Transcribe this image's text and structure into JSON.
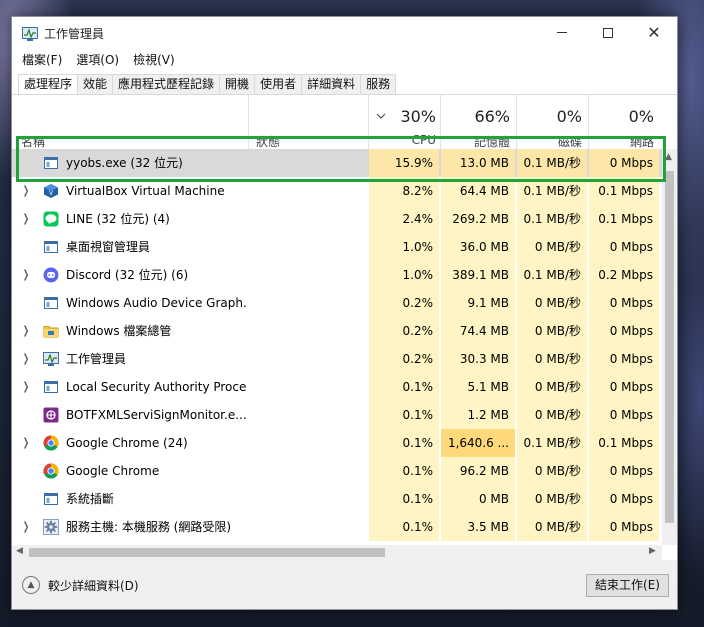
{
  "window": {
    "title": "工作管理員"
  },
  "menu": [
    "檔案(F)",
    "選項(O)",
    "檢視(V)"
  ],
  "tabs": [
    "處理程序",
    "效能",
    "應用程式歷程記錄",
    "開機",
    "使用者",
    "詳細資料",
    "服務"
  ],
  "active_tab": 0,
  "columns": {
    "name": "名稱",
    "status": "狀態",
    "cpu": {
      "pct": "30%",
      "label": "CPU"
    },
    "memory": {
      "pct": "66%",
      "label": "記憶體"
    },
    "disk": {
      "pct": "0%",
      "label": "磁碟"
    },
    "network": {
      "pct": "0%",
      "label": "網路"
    }
  },
  "processes": [
    {
      "name": "yyobs.exe (32 位元)",
      "icon": "app-window-icon",
      "expandable": false,
      "cpu": "15.9%",
      "mem": "13.0 MB",
      "disk": "0.1 MB/秒",
      "net": "0 Mbps",
      "selected": true
    },
    {
      "name": "VirtualBox Virtual Machine",
      "icon": "virtualbox-icon",
      "expandable": true,
      "cpu": "8.2%",
      "mem": "64.4 MB",
      "disk": "0.1 MB/秒",
      "net": "0.1 Mbps"
    },
    {
      "name": "LINE (32 位元) (4)",
      "icon": "line-icon",
      "expandable": true,
      "cpu": "2.4%",
      "mem": "269.2 MB",
      "disk": "0.1 MB/秒",
      "net": "0.1 Mbps"
    },
    {
      "name": "桌面視窗管理員",
      "icon": "app-window-icon",
      "expandable": false,
      "cpu": "1.0%",
      "mem": "36.0 MB",
      "disk": "0 MB/秒",
      "net": "0 Mbps"
    },
    {
      "name": "Discord (32 位元) (6)",
      "icon": "discord-icon",
      "expandable": true,
      "cpu": "1.0%",
      "mem": "389.1 MB",
      "disk": "0.1 MB/秒",
      "net": "0.2 Mbps"
    },
    {
      "name": "Windows Audio Device Graph...",
      "icon": "app-window-icon",
      "expandable": false,
      "cpu": "0.2%",
      "mem": "9.1 MB",
      "disk": "0 MB/秒",
      "net": "0 Mbps"
    },
    {
      "name": "Windows 檔案總管",
      "icon": "folder-icon",
      "expandable": true,
      "cpu": "0.2%",
      "mem": "74.4 MB",
      "disk": "0 MB/秒",
      "net": "0 Mbps"
    },
    {
      "name": "工作管理員",
      "icon": "task-manager-icon",
      "expandable": true,
      "cpu": "0.2%",
      "mem": "30.3 MB",
      "disk": "0 MB/秒",
      "net": "0 Mbps"
    },
    {
      "name": "Local Security Authority Proce...",
      "icon": "app-window-icon",
      "expandable": true,
      "cpu": "0.1%",
      "mem": "5.1 MB",
      "disk": "0 MB/秒",
      "net": "0 Mbps"
    },
    {
      "name": "BOTFXMLServiSignMonitor.e...",
      "icon": "signmonitor-icon",
      "expandable": false,
      "cpu": "0.1%",
      "mem": "1.2 MB",
      "disk": "0 MB/秒",
      "net": "0 Mbps"
    },
    {
      "name": "Google Chrome (24)",
      "icon": "chrome-icon",
      "expandable": true,
      "cpu": "0.1%",
      "mem": "1,640.6 ...",
      "disk": "0.1 MB/秒",
      "net": "0.1 Mbps",
      "mem_heat": 3
    },
    {
      "name": "Google Chrome",
      "icon": "chrome-icon",
      "expandable": false,
      "cpu": "0.1%",
      "mem": "96.2 MB",
      "disk": "0 MB/秒",
      "net": "0 Mbps"
    },
    {
      "name": "系統插斷",
      "icon": "app-window-icon",
      "expandable": false,
      "cpu": "0.1%",
      "mem": "0 MB",
      "disk": "0 MB/秒",
      "net": "0 Mbps"
    },
    {
      "name": "服務主機: 本機服務 (網路受限)",
      "icon": "gear-icon",
      "expandable": true,
      "cpu": "0.1%",
      "mem": "3.5 MB",
      "disk": "0 MB/秒",
      "net": "0 Mbps"
    }
  ],
  "footer": {
    "fewer_details": "較少詳細資料(D)",
    "end_task": "結束工作(E)"
  },
  "colors": {
    "highlight": "#22a33a",
    "heat_light": "#fff4c4",
    "heat_mid": "#ffe9a0",
    "heat_strong": "#ffd97a",
    "selected_row": "#d9d9d9"
  }
}
